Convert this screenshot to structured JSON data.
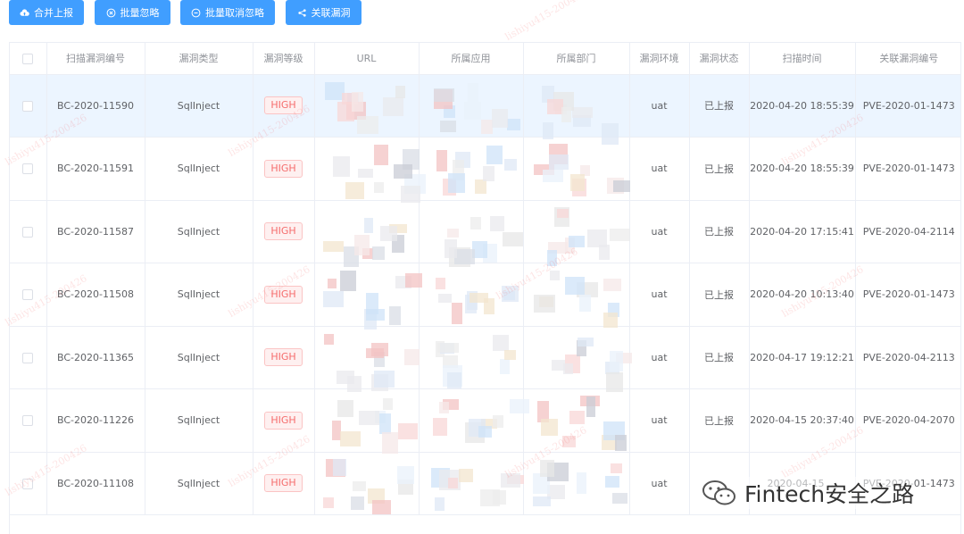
{
  "toolbar": {
    "merge_report": "合并上报",
    "batch_ignore": "批量忽略",
    "batch_unignore": "批量取消忽略",
    "link_vuln": "关联漏洞"
  },
  "table": {
    "headers": {
      "id": "扫描漏洞编号",
      "type": "漏洞类型",
      "level": "漏洞等级",
      "url": "URL",
      "app": "所属应用",
      "dept": "所属部门",
      "env": "漏洞环境",
      "status": "漏洞状态",
      "scan_time": "扫描时间",
      "related_id": "关联漏洞编号"
    },
    "rows": [
      {
        "id": "BC-2020-11590",
        "type": "SqlInject",
        "level": "HIGH",
        "env": "uat",
        "status": "已上报",
        "scan_time": "2020-04-20 18:55:39",
        "related_id": "PVE-2020-01-1473"
      },
      {
        "id": "BC-2020-11591",
        "type": "SqlInject",
        "level": "HIGH",
        "env": "uat",
        "status": "已上报",
        "scan_time": "2020-04-20 18:55:39",
        "related_id": "PVE-2020-01-1473"
      },
      {
        "id": "BC-2020-11587",
        "type": "SqlInject",
        "level": "HIGH",
        "env": "uat",
        "status": "已上报",
        "scan_time": "2020-04-20 17:15:41",
        "related_id": "PVE-2020-04-2114"
      },
      {
        "id": "BC-2020-11508",
        "type": "SqlInject",
        "level": "HIGH",
        "env": "uat",
        "status": "已上报",
        "scan_time": "2020-04-20 10:13:40",
        "related_id": "PVE-2020-01-1473"
      },
      {
        "id": "BC-2020-11365",
        "type": "SqlInject",
        "level": "HIGH",
        "env": "uat",
        "status": "已上报",
        "scan_time": "2020-04-17 19:12:21",
        "related_id": "PVE-2020-04-2113"
      },
      {
        "id": "BC-2020-11226",
        "type": "SqlInject",
        "level": "HIGH",
        "env": "uat",
        "status": "已上报",
        "scan_time": "2020-04-15 20:37:40",
        "related_id": "PVE-2020-04-2070"
      },
      {
        "id": "BC-2020-11108",
        "type": "SqlInject",
        "level": "HIGH",
        "env": "uat",
        "status": "",
        "scan_time": "2020-04-15 ...",
        "related_id": "PVE-2020-01-1473"
      }
    ]
  },
  "watermark": "lishiyu415-200426",
  "brand": "Fintech安全之路",
  "colors": {
    "primary": "#409eff",
    "danger": "#f56c6c",
    "selected_row": "#ecf5ff"
  }
}
